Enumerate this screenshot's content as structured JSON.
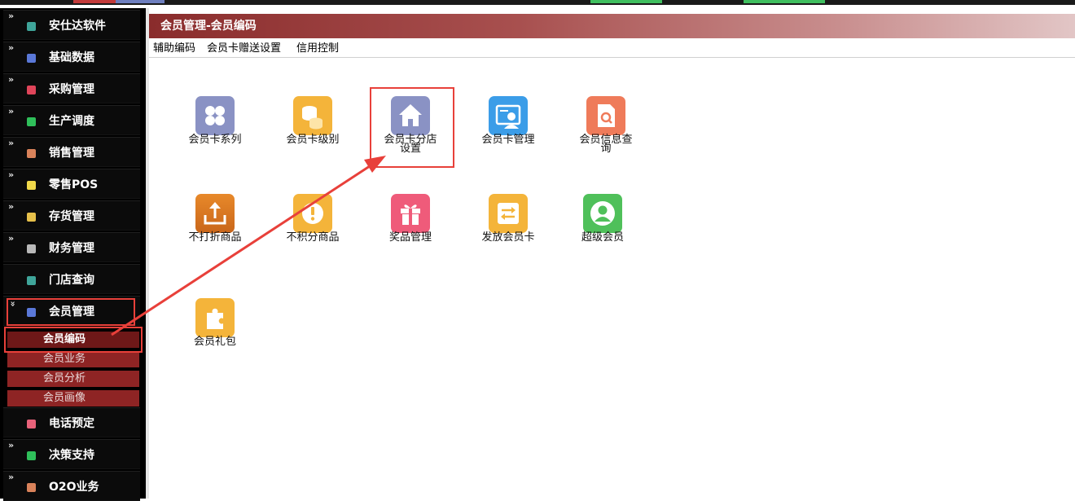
{
  "colors": {
    "sidebar_bg": "#000000",
    "submenu_bg": "#8e2424",
    "title_gradient_start": "#8a2c2c",
    "annotation_red": "#e8403a"
  },
  "sidebar": {
    "items": [
      {
        "label": "安仕达软件",
        "icon": "teal-cube-icon",
        "color": "#3fa59a",
        "chevron": true
      },
      {
        "label": "基础数据",
        "icon": "blue-cube-icon",
        "color": "#5a78d8",
        "chevron": true
      },
      {
        "label": "采购管理",
        "icon": "red-cube-icon",
        "color": "#e0455a",
        "chevron": true
      },
      {
        "label": "生产调度",
        "icon": "green-cube-icon",
        "color": "#2fbf5a",
        "chevron": true
      },
      {
        "label": "销售管理",
        "icon": "orange-cube-icon",
        "color": "#d9825a",
        "chevron": true
      },
      {
        "label": "零售POS",
        "icon": "yellow-cube-icon",
        "color": "#f0d84a",
        "chevron": true
      },
      {
        "label": "存货管理",
        "icon": "gold-cube-icon",
        "color": "#e6c04a",
        "chevron": true
      },
      {
        "label": "财务管理",
        "icon": "gray-cube-icon",
        "color": "#b9b9b9",
        "chevron": true
      },
      {
        "label": "门店查询",
        "icon": "teal-cube-icon",
        "color": "#3fa59a",
        "chevron": false
      },
      {
        "label": "会员管理",
        "icon": "blue-cube-icon",
        "color": "#5a78d8",
        "chevron": true,
        "expanded": true
      }
    ],
    "subitems": [
      {
        "label": "会员编码",
        "active": true
      },
      {
        "label": "会员业务",
        "active": false
      },
      {
        "label": "会员分析",
        "active": false
      },
      {
        "label": "会员画像",
        "active": false
      }
    ],
    "items_after": [
      {
        "label": "电话预定",
        "icon": "pink-cube-icon",
        "color": "#e8627a",
        "chevron": false
      },
      {
        "label": "决策支持",
        "icon": "green-cube-icon",
        "color": "#2fbf5a",
        "chevron": true
      },
      {
        "label": "O2O业务",
        "icon": "orange-cube-icon",
        "color": "#d9825a",
        "chevron": true
      }
    ]
  },
  "header": {
    "title": "会员管理-会员编码"
  },
  "submenu": {
    "links": [
      "辅助编码",
      "会员卡赠送设置",
      "信用控制"
    ]
  },
  "tiles": [
    {
      "label_line1": "会员卡系列",
      "label_line2": "",
      "icon": "clover-icon",
      "color": "#8a92c4"
    },
    {
      "label_line1": "会员卡级别",
      "label_line2": "",
      "icon": "coins-icon",
      "color": "#f4b43a"
    },
    {
      "label_line1": "会员卡分店",
      "label_line2": "设置",
      "icon": "house-icon",
      "color": "#8a92c4"
    },
    {
      "label_line1": "会员卡管理",
      "label_line2": "",
      "icon": "id-card-icon",
      "color": "#3b9de8"
    },
    {
      "label_line1": "会员信息查",
      "label_line2": "询",
      "icon": "doc-search-icon",
      "color": "#ef7b5a"
    },
    {
      "label_line1": "不打折商品",
      "label_line2": "",
      "icon": "export-icon",
      "color": "#e07b1f"
    },
    {
      "label_line1": "不积分商品",
      "label_line2": "",
      "icon": "alert-icon",
      "color": "#f4b43a"
    },
    {
      "label_line1": "奖品管理",
      "label_line2": "",
      "icon": "gift-icon",
      "color": "#ef5b7a"
    },
    {
      "label_line1": "发放会员卡",
      "label_line2": "",
      "icon": "swap-icon",
      "color": "#f4b43a"
    },
    {
      "label_line1": "超级会员",
      "label_line2": "",
      "icon": "user-circle-icon",
      "color": "#4fc05a"
    },
    {
      "label_line1": "会员礼包",
      "label_line2": "",
      "icon": "puzzle-icon",
      "color": "#f4b43a"
    }
  ]
}
